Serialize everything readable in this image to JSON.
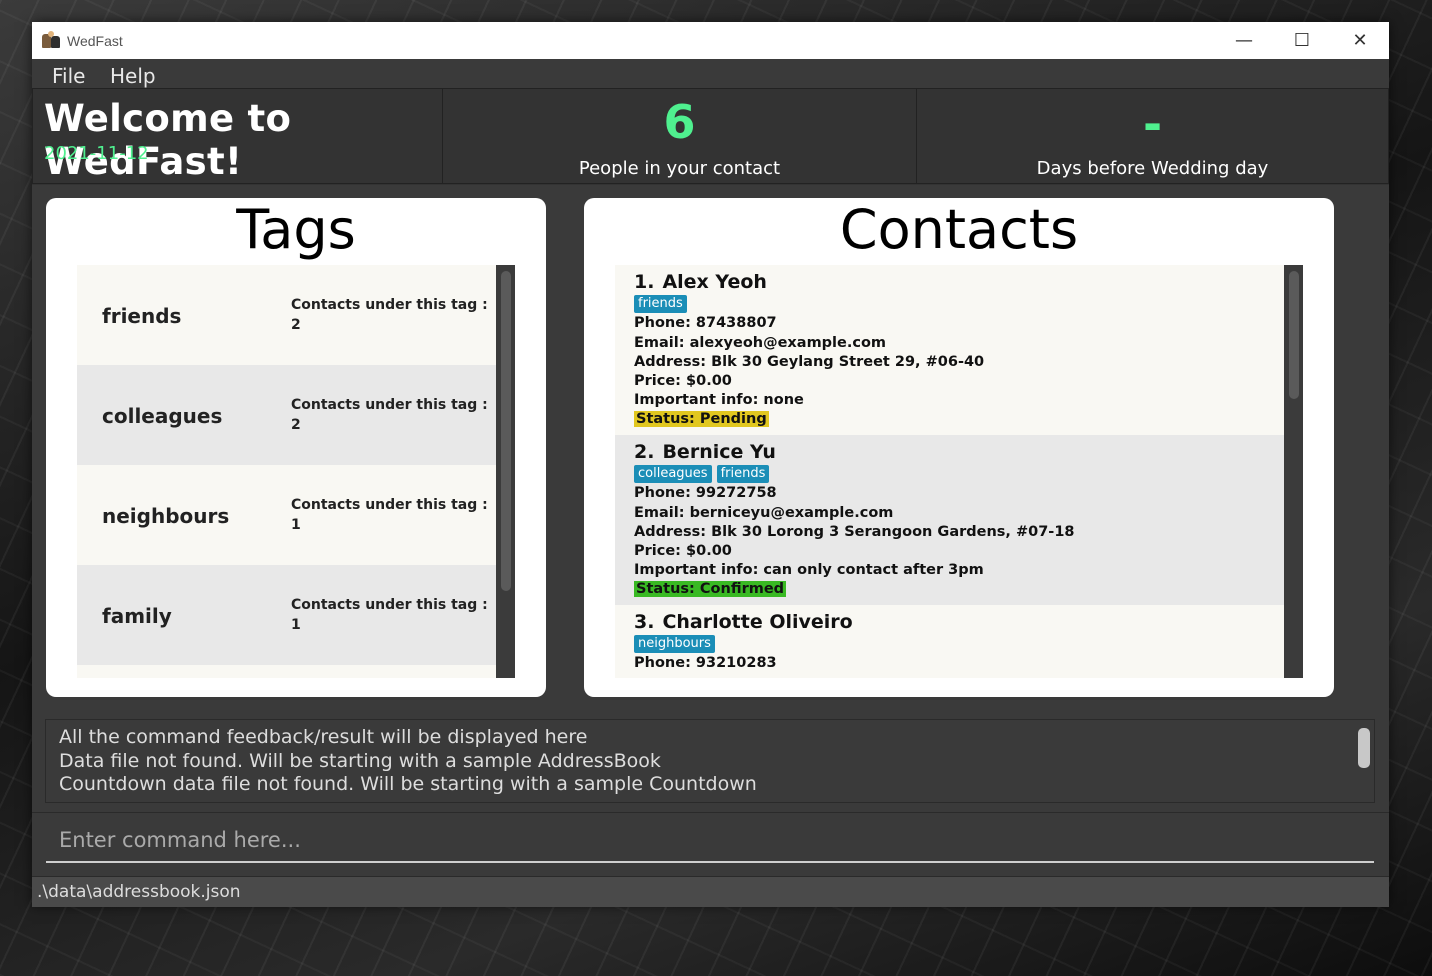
{
  "window": {
    "title": "WedFast",
    "minimize": "—",
    "maximize": "☐",
    "close": "✕"
  },
  "menu": {
    "file": "File",
    "help": "Help"
  },
  "header": {
    "welcome": "Welcome to WedFast!",
    "date": "2021-11-12",
    "contacts_count": "6",
    "contacts_label": "People in your contact",
    "days_value": "-",
    "days_label": "Days before Wedding day"
  },
  "tags_panel": {
    "title": "Tags",
    "items": [
      {
        "name": "friends",
        "count_label": "Contacts under this tag :",
        "count": "2"
      },
      {
        "name": "colleagues",
        "count_label": "Contacts under this tag :",
        "count": "2"
      },
      {
        "name": "neighbours",
        "count_label": "Contacts under this tag :",
        "count": "1"
      },
      {
        "name": "family",
        "count_label": "Contacts under this tag :",
        "count": "1"
      }
    ]
  },
  "contacts_panel": {
    "title": "Contacts",
    "items": [
      {
        "index": "1.",
        "name": "Alex Yeoh",
        "tags": [
          "friends"
        ],
        "phone": "Phone: 87438807",
        "email": "Email: alexyeoh@example.com",
        "address": "Address: Blk 30 Geylang Street 29, #06-40",
        "price": "Price: $0.00",
        "info": "Important info: none",
        "status": "Status: Pending"
      },
      {
        "index": "2.",
        "name": "Bernice Yu",
        "tags": [
          "colleagues",
          "friends"
        ],
        "phone": "Phone: 99272758",
        "email": "Email: berniceyu@example.com",
        "address": "Address: Blk 30 Lorong 3 Serangoon Gardens, #07-18",
        "price": "Price: $0.00",
        "info": "Important info: can only contact after 3pm",
        "status": "Status: Confirmed"
      },
      {
        "index": "3.",
        "name": "Charlotte Oliveiro",
        "tags": [
          "neighbours"
        ],
        "phone": "Phone: 93210283"
      }
    ]
  },
  "feedback": {
    "lines": [
      "All the command feedback/result will be displayed here",
      "Data file not found. Will be starting with a sample AddressBook",
      "Countdown data file not found. Will be starting with a sample Countdown"
    ]
  },
  "command": {
    "placeholder": "Enter command here..."
  },
  "statusbar": {
    "path": ".\\data\\addressbook.json"
  },
  "colors": {
    "accent_green": "#4ff08f",
    "tag_chip": "#1b8eb7",
    "status_pending": "#e1c71f",
    "status_confirmed": "#39b923",
    "row_light": "#f9f8f3",
    "row_dark": "#e8e8e8"
  }
}
